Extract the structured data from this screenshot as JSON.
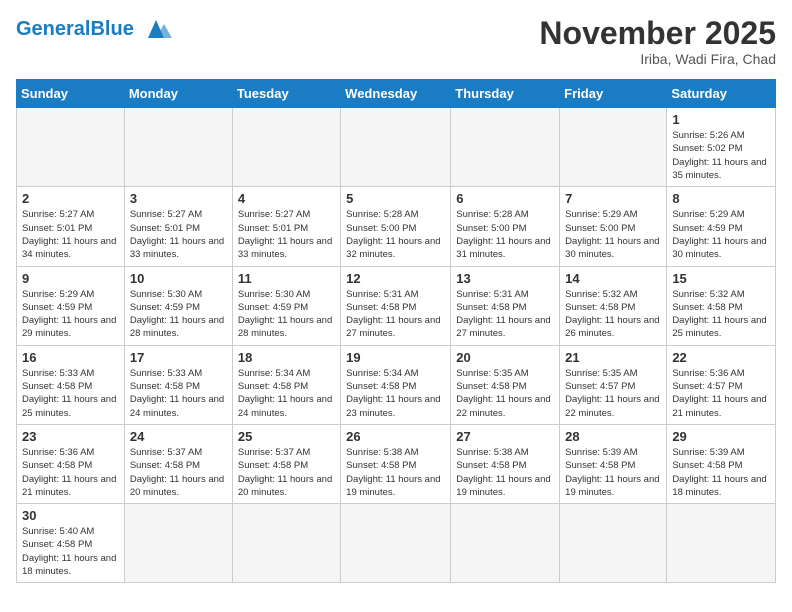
{
  "logo": {
    "general": "General",
    "blue": "Blue"
  },
  "header": {
    "month": "November 2025",
    "location": "Iriba, Wadi Fira, Chad"
  },
  "weekdays": [
    "Sunday",
    "Monday",
    "Tuesday",
    "Wednesday",
    "Thursday",
    "Friday",
    "Saturday"
  ],
  "weeks": [
    [
      {
        "day": "",
        "info": ""
      },
      {
        "day": "",
        "info": ""
      },
      {
        "day": "",
        "info": ""
      },
      {
        "day": "",
        "info": ""
      },
      {
        "day": "",
        "info": ""
      },
      {
        "day": "",
        "info": ""
      },
      {
        "day": "1",
        "info": "Sunrise: 5:26 AM\nSunset: 5:02 PM\nDaylight: 11 hours and 35 minutes."
      }
    ],
    [
      {
        "day": "2",
        "info": "Sunrise: 5:27 AM\nSunset: 5:01 PM\nDaylight: 11 hours and 34 minutes."
      },
      {
        "day": "3",
        "info": "Sunrise: 5:27 AM\nSunset: 5:01 PM\nDaylight: 11 hours and 33 minutes."
      },
      {
        "day": "4",
        "info": "Sunrise: 5:27 AM\nSunset: 5:01 PM\nDaylight: 11 hours and 33 minutes."
      },
      {
        "day": "5",
        "info": "Sunrise: 5:28 AM\nSunset: 5:00 PM\nDaylight: 11 hours and 32 minutes."
      },
      {
        "day": "6",
        "info": "Sunrise: 5:28 AM\nSunset: 5:00 PM\nDaylight: 11 hours and 31 minutes."
      },
      {
        "day": "7",
        "info": "Sunrise: 5:29 AM\nSunset: 5:00 PM\nDaylight: 11 hours and 30 minutes."
      },
      {
        "day": "8",
        "info": "Sunrise: 5:29 AM\nSunset: 4:59 PM\nDaylight: 11 hours and 30 minutes."
      }
    ],
    [
      {
        "day": "9",
        "info": "Sunrise: 5:29 AM\nSunset: 4:59 PM\nDaylight: 11 hours and 29 minutes."
      },
      {
        "day": "10",
        "info": "Sunrise: 5:30 AM\nSunset: 4:59 PM\nDaylight: 11 hours and 28 minutes."
      },
      {
        "day": "11",
        "info": "Sunrise: 5:30 AM\nSunset: 4:59 PM\nDaylight: 11 hours and 28 minutes."
      },
      {
        "day": "12",
        "info": "Sunrise: 5:31 AM\nSunset: 4:58 PM\nDaylight: 11 hours and 27 minutes."
      },
      {
        "day": "13",
        "info": "Sunrise: 5:31 AM\nSunset: 4:58 PM\nDaylight: 11 hours and 27 minutes."
      },
      {
        "day": "14",
        "info": "Sunrise: 5:32 AM\nSunset: 4:58 PM\nDaylight: 11 hours and 26 minutes."
      },
      {
        "day": "15",
        "info": "Sunrise: 5:32 AM\nSunset: 4:58 PM\nDaylight: 11 hours and 25 minutes."
      }
    ],
    [
      {
        "day": "16",
        "info": "Sunrise: 5:33 AM\nSunset: 4:58 PM\nDaylight: 11 hours and 25 minutes."
      },
      {
        "day": "17",
        "info": "Sunrise: 5:33 AM\nSunset: 4:58 PM\nDaylight: 11 hours and 24 minutes."
      },
      {
        "day": "18",
        "info": "Sunrise: 5:34 AM\nSunset: 4:58 PM\nDaylight: 11 hours and 24 minutes."
      },
      {
        "day": "19",
        "info": "Sunrise: 5:34 AM\nSunset: 4:58 PM\nDaylight: 11 hours and 23 minutes."
      },
      {
        "day": "20",
        "info": "Sunrise: 5:35 AM\nSunset: 4:58 PM\nDaylight: 11 hours and 22 minutes."
      },
      {
        "day": "21",
        "info": "Sunrise: 5:35 AM\nSunset: 4:57 PM\nDaylight: 11 hours and 22 minutes."
      },
      {
        "day": "22",
        "info": "Sunrise: 5:36 AM\nSunset: 4:57 PM\nDaylight: 11 hours and 21 minutes."
      }
    ],
    [
      {
        "day": "23",
        "info": "Sunrise: 5:36 AM\nSunset: 4:58 PM\nDaylight: 11 hours and 21 minutes."
      },
      {
        "day": "24",
        "info": "Sunrise: 5:37 AM\nSunset: 4:58 PM\nDaylight: 11 hours and 20 minutes."
      },
      {
        "day": "25",
        "info": "Sunrise: 5:37 AM\nSunset: 4:58 PM\nDaylight: 11 hours and 20 minutes."
      },
      {
        "day": "26",
        "info": "Sunrise: 5:38 AM\nSunset: 4:58 PM\nDaylight: 11 hours and 19 minutes."
      },
      {
        "day": "27",
        "info": "Sunrise: 5:38 AM\nSunset: 4:58 PM\nDaylight: 11 hours and 19 minutes."
      },
      {
        "day": "28",
        "info": "Sunrise: 5:39 AM\nSunset: 4:58 PM\nDaylight: 11 hours and 19 minutes."
      },
      {
        "day": "29",
        "info": "Sunrise: 5:39 AM\nSunset: 4:58 PM\nDaylight: 11 hours and 18 minutes."
      }
    ],
    [
      {
        "day": "30",
        "info": "Sunrise: 5:40 AM\nSunset: 4:58 PM\nDaylight: 11 hours and 18 minutes."
      },
      {
        "day": "",
        "info": ""
      },
      {
        "day": "",
        "info": ""
      },
      {
        "day": "",
        "info": ""
      },
      {
        "day": "",
        "info": ""
      },
      {
        "day": "",
        "info": ""
      },
      {
        "day": "",
        "info": ""
      }
    ]
  ]
}
